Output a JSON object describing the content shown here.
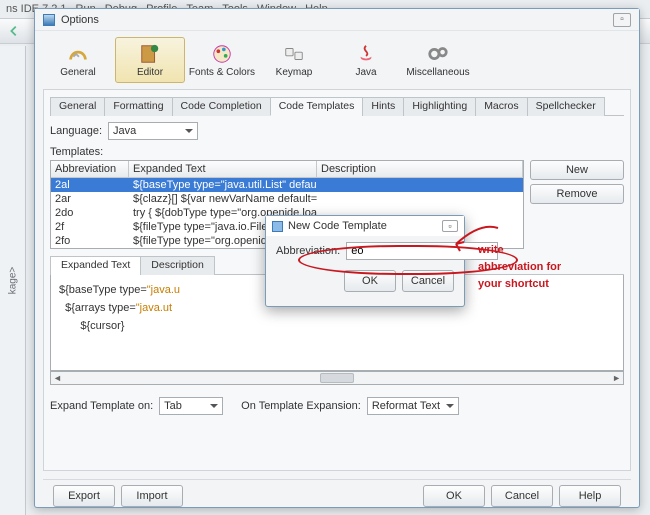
{
  "app": {
    "title_suffix": "ns IDE 7.2.1"
  },
  "menu": [
    "Run",
    "Debug",
    "Profile",
    "Team",
    "Tools",
    "Window",
    "Help"
  ],
  "leftpanel": {
    "label": "kage>"
  },
  "options": {
    "title": "Options",
    "bigbuttons": [
      {
        "label": "General"
      },
      {
        "label": "Editor",
        "selected": true
      },
      {
        "label": "Fonts & Colors"
      },
      {
        "label": "Keymap"
      },
      {
        "label": "Java"
      },
      {
        "label": "Miscellaneous"
      }
    ],
    "subtabs": [
      "General",
      "Formatting",
      "Code Completion",
      "Code Templates",
      "Hints",
      "Highlighting",
      "Macros",
      "Spellchecker"
    ],
    "subtabs_active": 3,
    "language": {
      "label": "Language:",
      "value": "Java"
    },
    "templates_label": "Templates:",
    "headers": {
      "abbrev": "Abbreviation",
      "expanded": "Expanded Text",
      "desc": "Description"
    },
    "rows": [
      {
        "abbrev": "2al",
        "expanded": "${baseType type=\"java.util.List\" default=\"Li...",
        "desc": "",
        "selected": true
      },
      {
        "abbrev": "2ar",
        "expanded": "${clazz}[] ${var newVarName default=\"arr\"...",
        "desc": ""
      },
      {
        "abbrev": "2do",
        "expanded": "try {    ${dobType type=\"org.openide.loade...",
        "desc": ""
      },
      {
        "abbrev": "2f",
        "expanded": "${fileType type=\"java.io.File\" default=\"File\"...",
        "desc": ""
      },
      {
        "abbrev": "2fo",
        "expanded": "${fileType type=\"org.openide.fi",
        "desc": ""
      }
    ],
    "sidebuttons": {
      "new": "New",
      "remove": "Remove"
    },
    "tabs2": {
      "items": [
        "Expanded Text",
        "Description"
      ],
      "active": 0
    },
    "code": {
      "l1a": "${baseType type=",
      "l1b": "\"java.u",
      "l2a": "  ${arrays type=",
      "l2b": "\"java.ut",
      "l3": "       ${cursor}"
    },
    "expand": {
      "label": "Expand Template on:",
      "value": "Tab",
      "on_label": "On Template Expansion:",
      "on_value": "Reformat Text"
    },
    "bottom": {
      "export": "Export",
      "import": "Import",
      "ok": "OK",
      "cancel": "Cancel",
      "help": "Help"
    }
  },
  "popup": {
    "title": "New Code Template",
    "label": "Abbreviation:",
    "value": "eo",
    "ok": "OK",
    "cancel": "Cancel"
  },
  "annotation": {
    "text1": "write",
    "text2": "abbreviation for",
    "text3": "your shortcut"
  }
}
